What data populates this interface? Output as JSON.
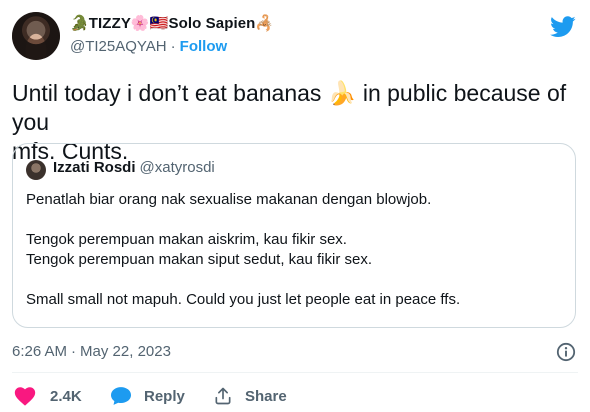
{
  "author": {
    "display_name": "🐊TIZZY🌸🇲🇾Solo Sapien🦂",
    "handle": "@TI25AQYAH",
    "separator": "·",
    "follow_label": "Follow"
  },
  "tweet": {
    "text_line1": "Until today i don’t eat bananas 🍌 in public because of you",
    "text_line2": "mfs. Cunts."
  },
  "quoted": {
    "name": "Izzati Rosdi",
    "handle": "@xatyrosdi",
    "lines": [
      "Penatlah biar orang nak sexualise makanan dengan blowjob.",
      "",
      "Tengok perempuan makan aiskrim, kau fikir sex.",
      "Tengok perempuan makan siput sedut, kau fikir sex.",
      "",
      "Small small not mapuh. Could you just let people eat in peace ffs."
    ]
  },
  "meta": {
    "time": "6:26 AM",
    "separator": "·",
    "date": "May 22, 2023"
  },
  "actions": {
    "like_count": "2.4K",
    "reply_label": "Reply",
    "share_label": "Share"
  },
  "icons": {
    "brand": "twitter-bird-icon",
    "like": "heart-icon",
    "reply": "speech-bubble-icon",
    "share": "share-upload-icon",
    "info": "info-circle-icon"
  },
  "colors": {
    "brand_blue": "#1d9bf0",
    "like_pink": "#f91880",
    "text_primary": "#0f1419",
    "text_secondary": "#536471",
    "border": "#cfd9de"
  }
}
